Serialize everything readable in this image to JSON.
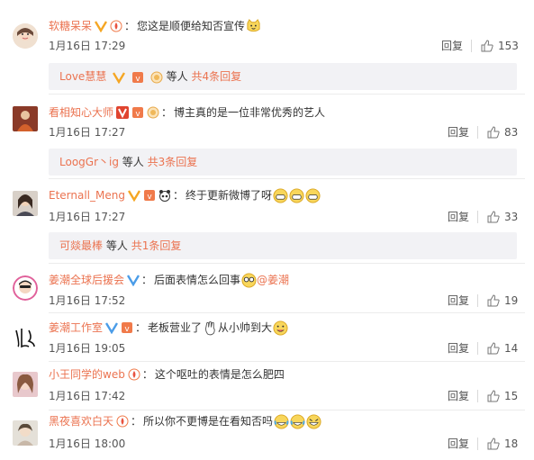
{
  "comments": [
    {
      "user": "软糖呆呆",
      "text": "您这是顺便给知否宣传",
      "mention": "",
      "date": "1月16日 17:29",
      "reply": "回复",
      "likes": "153"
    },
    {
      "user": "看相知心大师",
      "text": "博主真的是一位非常优秀的艺人",
      "mention": "",
      "date": "1月16日 17:27",
      "reply": "回复",
      "likes": "83"
    },
    {
      "user": "Eternall_Meng",
      "text": "终于更新微博了呀",
      "mention": "",
      "date": "1月16日 17:27",
      "reply": "回复",
      "likes": "33"
    },
    {
      "user": "姜潮全球后援会",
      "text": "后面表情怎么回事",
      "mention": "@姜潮",
      "date": "1月16日 17:52",
      "reply": "回复",
      "likes": "19"
    },
    {
      "user": "姜潮工作室",
      "text": "老板营业了",
      "text2": "从小帅到大",
      "mention": "",
      "date": "1月16日 19:05",
      "reply": "回复",
      "likes": "14"
    },
    {
      "user": "小王同学的web",
      "text": "这个呕吐的表情是怎么肥四",
      "mention": "",
      "date": "1月16日 17:42",
      "reply": "回复",
      "likes": "15"
    },
    {
      "user": "黑夜喜欢白天",
      "text": "所以你不更博是在看知否吗",
      "mention": "",
      "date": "1月16日 18:00",
      "reply": "回复",
      "likes": "18"
    }
  ],
  "subreplies": [
    {
      "name": "Love慧慧",
      "suffix": "等人",
      "count": "共4条回复"
    },
    {
      "name": "LoogGr丶ig",
      "suffix": "等人",
      "count": "共3条回复"
    },
    {
      "name": "可燚最棒",
      "suffix": "等人",
      "count": "共1条回复"
    }
  ],
  "colors": {
    "username": "#eb7350",
    "text": "#333333",
    "meta": "#555555",
    "vip": "#f5a623",
    "subbox_bg": "#f2f2f5"
  },
  "icons": [
    "avatar",
    "verified-v-icon",
    "vip-badge-icon",
    "thumbs-up-icon",
    "emoji-icon"
  ]
}
